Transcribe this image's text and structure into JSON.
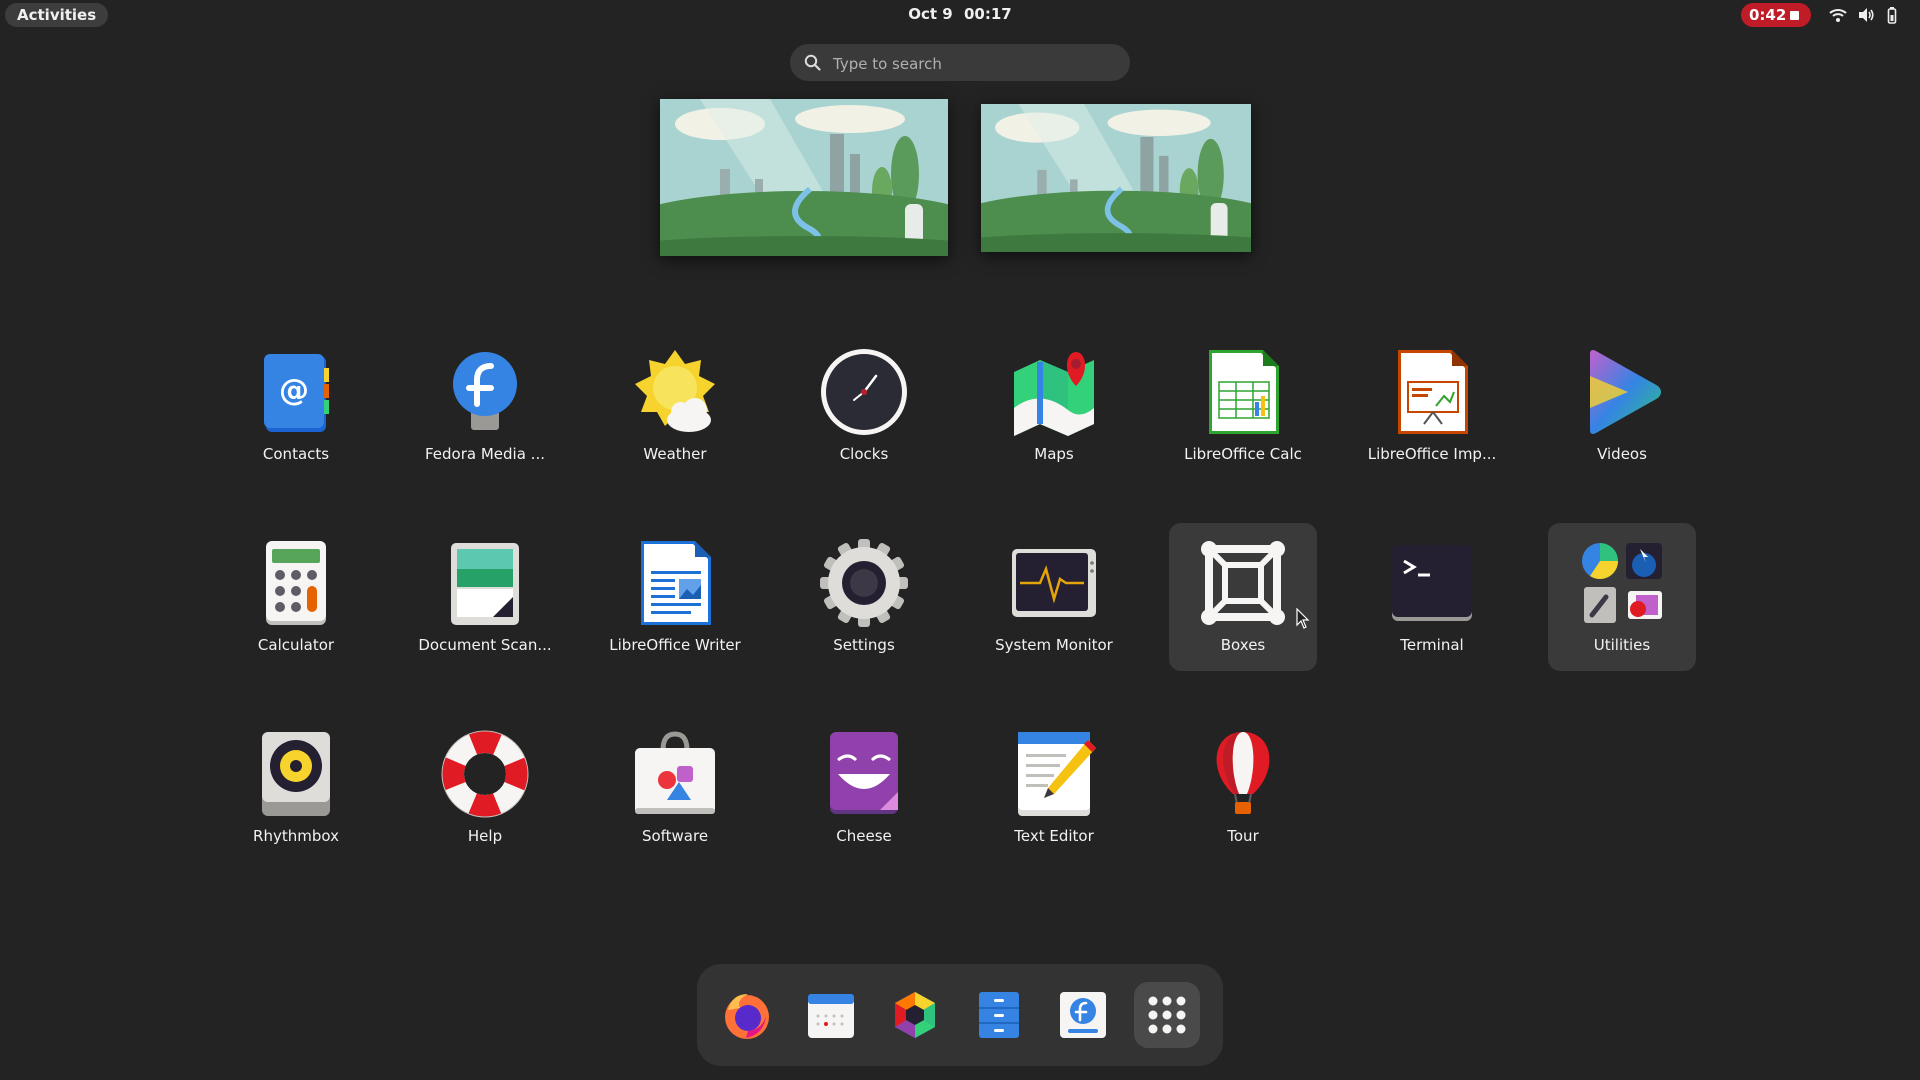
{
  "topbar": {
    "activities_label": "Activities",
    "date": "Oct 9",
    "time": "00:17",
    "recording_time": "0:42",
    "tray_icons": [
      "wifi-icon",
      "volume-icon",
      "battery-icon"
    ]
  },
  "search": {
    "placeholder": "Type to search"
  },
  "apps": [
    {
      "label": "Contacts",
      "icon": "contacts-icon"
    },
    {
      "label": "Fedora Media ...",
      "icon": "fedora-media-writer-icon"
    },
    {
      "label": "Weather",
      "icon": "weather-icon"
    },
    {
      "label": "Clocks",
      "icon": "clock-icon"
    },
    {
      "label": "Maps",
      "icon": "maps-icon"
    },
    {
      "label": "LibreOffice Calc",
      "icon": "libreoffice-calc-icon"
    },
    {
      "label": "LibreOffice Imp...",
      "icon": "libreoffice-impress-icon"
    },
    {
      "label": "Videos",
      "icon": "videos-icon"
    },
    {
      "label": "Calculator",
      "icon": "calculator-icon"
    },
    {
      "label": "Document Scan...",
      "icon": "document-scanner-icon"
    },
    {
      "label": "LibreOffice Writer",
      "icon": "libreoffice-writer-icon"
    },
    {
      "label": "Settings",
      "icon": "gear-icon"
    },
    {
      "label": "System Monitor",
      "icon": "system-monitor-icon"
    },
    {
      "label": "Boxes",
      "icon": "boxes-icon"
    },
    {
      "label": "Terminal",
      "icon": "terminal-icon"
    },
    {
      "label": "Utilities",
      "icon": "utilities-folder-icon"
    },
    {
      "label": "Rhythmbox",
      "icon": "rhythmbox-icon"
    },
    {
      "label": "Help",
      "icon": "help-lifebuoy-icon"
    },
    {
      "label": "Software",
      "icon": "software-icon"
    },
    {
      "label": "Cheese",
      "icon": "cheese-icon"
    },
    {
      "label": "Text Editor",
      "icon": "text-editor-icon"
    },
    {
      "label": "Tour",
      "icon": "tour-balloon-icon"
    }
  ],
  "dock": [
    "firefox-icon",
    "calendar-icon",
    "photos-icon",
    "files-icon",
    "fedora-media-writer-icon",
    "app-grid-icon"
  ],
  "colors": {
    "background": "#232323",
    "recording": "#c01c28",
    "highlight": "#3a3a3a"
  }
}
